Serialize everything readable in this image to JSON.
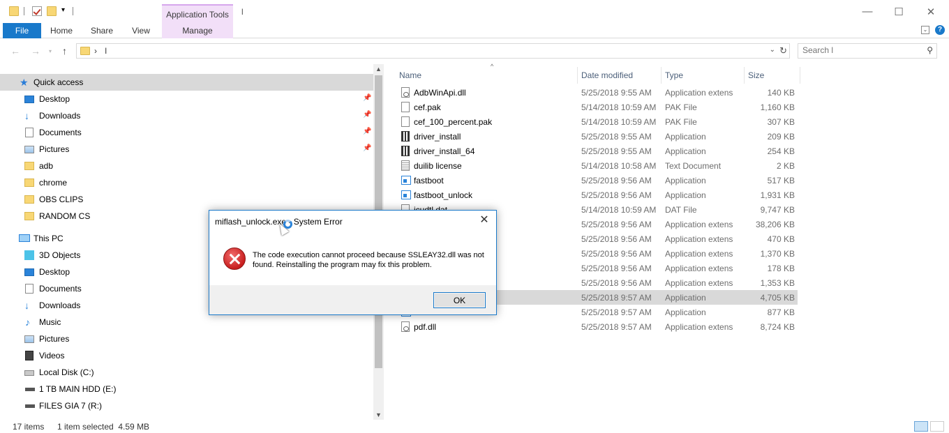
{
  "titlebar": {
    "context_tab_group": "Application Tools",
    "title_text": "l",
    "minimize": "—",
    "maximize": "☐",
    "close": "✕"
  },
  "ribbon": {
    "tabs": [
      {
        "label": "File"
      },
      {
        "label": "Home"
      },
      {
        "label": "Share"
      },
      {
        "label": "View"
      },
      {
        "label": "Manage"
      }
    ],
    "help": "?"
  },
  "address": {
    "separator": "›",
    "current": "l",
    "search_placeholder": "Search l"
  },
  "navpane": {
    "items": [
      {
        "label": "Quick access",
        "icon": "star-icon"
      },
      {
        "label": "Desktop",
        "icon": "desktop-icon",
        "pinned": true
      },
      {
        "label": "Downloads",
        "icon": "download-icon",
        "pinned": true
      },
      {
        "label": "Documents",
        "icon": "document-icon",
        "pinned": true
      },
      {
        "label": "Pictures",
        "icon": "pictures-icon",
        "pinned": true
      },
      {
        "label": "adb",
        "icon": "folder-icon"
      },
      {
        "label": "chrome",
        "icon": "folder-icon"
      },
      {
        "label": "OBS CLIPS",
        "icon": "folder-icon"
      },
      {
        "label": "RANDOM CS",
        "icon": "folder-icon"
      },
      {
        "label": "This PC",
        "icon": "computer-icon"
      },
      {
        "label": "3D Objects",
        "icon": "3d-objects-icon"
      },
      {
        "label": "Desktop",
        "icon": "desktop-icon"
      },
      {
        "label": "Documents",
        "icon": "document-icon"
      },
      {
        "label": "Downloads",
        "icon": "download-icon"
      },
      {
        "label": "Music",
        "icon": "music-icon"
      },
      {
        "label": "Pictures",
        "icon": "pictures-icon"
      },
      {
        "label": "Videos",
        "icon": "videos-icon"
      },
      {
        "label": "Local Disk (C:)",
        "icon": "local-disk-icon"
      },
      {
        "label": "1 TB MAIN HDD (E:)",
        "icon": "hdd-icon"
      },
      {
        "label": "FILES GIA 7 (R:)",
        "icon": "hdd-icon"
      }
    ]
  },
  "filelist": {
    "columns": [
      "Name",
      "Date modified",
      "Type",
      "Size"
    ],
    "rows": [
      {
        "name": "AdbWinApi.dll",
        "date": "5/25/2018 9:55 AM",
        "type": "Application extens",
        "size": "140 KB",
        "icon": "dll-icon"
      },
      {
        "name": "cef.pak",
        "date": "5/14/2018 10:59 AM",
        "type": "PAK File",
        "size": "1,160 KB",
        "icon": "file-icon"
      },
      {
        "name": "cef_100_percent.pak",
        "date": "5/14/2018 10:59 AM",
        "type": "PAK File",
        "size": "307 KB",
        "icon": "file-icon"
      },
      {
        "name": "driver_install",
        "date": "5/25/2018 9:55 AM",
        "type": "Application",
        "size": "209 KB",
        "icon": "installer-icon"
      },
      {
        "name": "driver_install_64",
        "date": "5/25/2018 9:55 AM",
        "type": "Application",
        "size": "254 KB",
        "icon": "installer-icon"
      },
      {
        "name": "duilib license",
        "date": "5/14/2018 10:58 AM",
        "type": "Text Document",
        "size": "2 KB",
        "icon": "text-file-icon"
      },
      {
        "name": "fastboot",
        "date": "5/25/2018 9:56 AM",
        "type": "Application",
        "size": "517 KB",
        "icon": "exe-icon"
      },
      {
        "name": "fastboot_unlock",
        "date": "5/25/2018 9:56 AM",
        "type": "Application",
        "size": "1,931 KB",
        "icon": "exe-icon"
      },
      {
        "name": "icudtl.dat",
        "date": "5/14/2018 10:59 AM",
        "type": "DAT File",
        "size": "9,747 KB",
        "icon": "file-icon"
      },
      {
        "name": "",
        "date": "5/25/2018 9:56 AM",
        "type": "Application extens",
        "size": "38,206 KB",
        "icon": "dll-icon"
      },
      {
        "name": "",
        "date": "5/25/2018 9:56 AM",
        "type": "Application extens",
        "size": "470 KB",
        "icon": "dll-icon"
      },
      {
        "name": "",
        "date": "5/25/2018 9:56 AM",
        "type": "Application extens",
        "size": "1,370 KB",
        "icon": "dll-icon"
      },
      {
        "name": "",
        "date": "5/25/2018 9:56 AM",
        "type": "Application extens",
        "size": "178 KB",
        "icon": "dll-icon"
      },
      {
        "name": "",
        "date": "5/25/2018 9:56 AM",
        "type": "Application extens",
        "size": "1,353 KB",
        "icon": "dll-icon"
      },
      {
        "name": "",
        "date": "5/25/2018 9:57 AM",
        "type": "Application",
        "size": "4,705 KB",
        "icon": "exe-icon",
        "selected": true
      },
      {
        "name": "",
        "date": "5/25/2018 9:57 AM",
        "type": "Application",
        "size": "877 KB",
        "icon": "exe-icon"
      },
      {
        "name": "pdf.dll",
        "date": "5/25/2018 9:57 AM",
        "type": "Application extens",
        "size": "8,724 KB",
        "icon": "dll-icon"
      }
    ]
  },
  "status": {
    "item_count": "17 items",
    "selection": "1 item selected  4.59 MB"
  },
  "dialog": {
    "title": "miflash_unlock.exe - System Error",
    "message": "The code execution cannot proceed because SSLEAY32.dll was not found. Reinstalling the program may fix this problem.",
    "ok_label": "OK",
    "close": "✕"
  },
  "colors": {
    "accent": "#1979ca",
    "context_tab": "#f2dff8",
    "selection": "#d9d9d9",
    "error_red": "#c81e1e"
  }
}
